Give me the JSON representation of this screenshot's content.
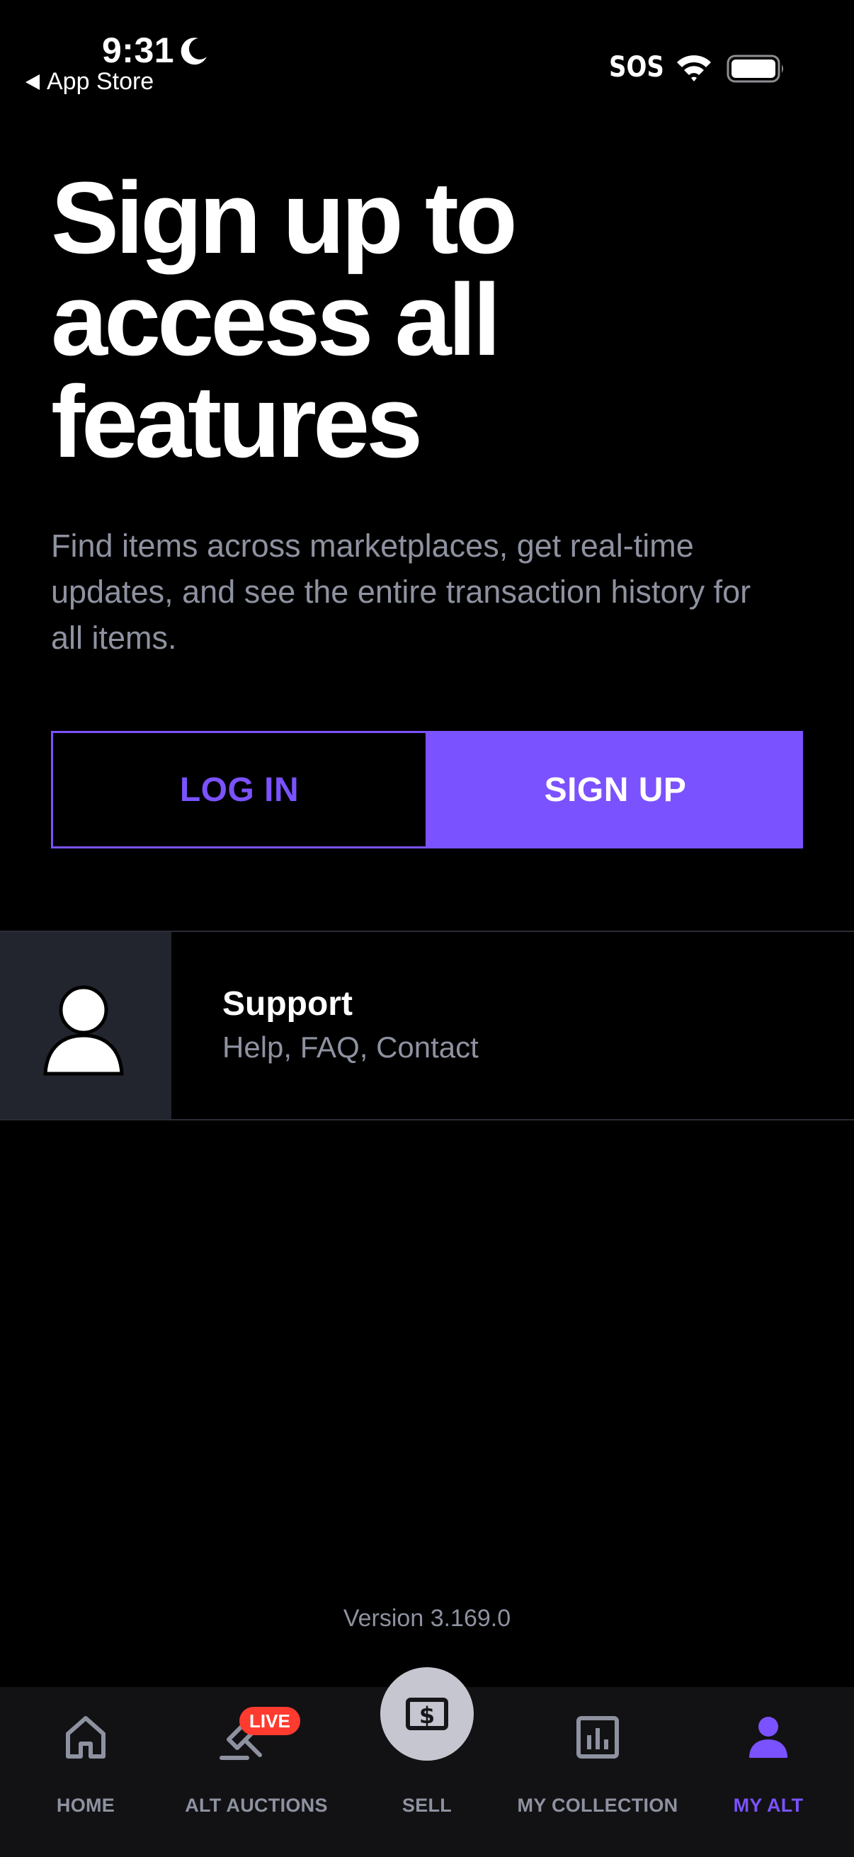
{
  "status_bar": {
    "time": "9:31",
    "back_label": "App Store",
    "sos": "SOS"
  },
  "hero": {
    "headline_lines": [
      "Sign up to",
      "access all",
      "features"
    ],
    "subtitle_lines": [
      "Find items across marketplaces, get real-time",
      "updates, and see the entire transaction history for",
      "all items."
    ]
  },
  "auth": {
    "login_label": "LOG IN",
    "signup_label": "SIGN UP"
  },
  "support": {
    "title": "Support",
    "subtitle": "Help, FAQ, Contact"
  },
  "version": "Version 3.169.0",
  "tab_bar": {
    "home": "HOME",
    "auctions": "ALT AUCTIONS",
    "live_badge": "LIVE",
    "sell": "SELL",
    "collection": "MY COLLECTION",
    "my_alt": "MY ALT"
  },
  "colors": {
    "accent": "#7b52ff",
    "live": "#ff3b30",
    "muted_text": "#8e92a0",
    "background": "#000000"
  }
}
